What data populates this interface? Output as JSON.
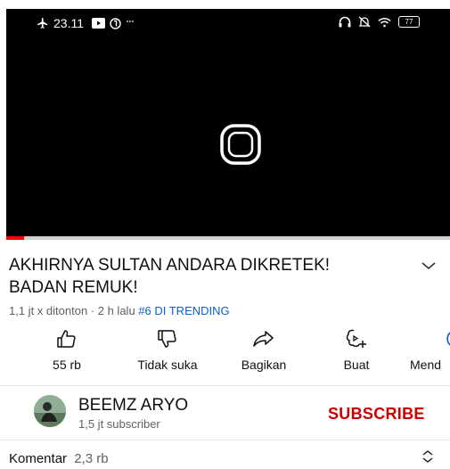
{
  "status_bar": {
    "time": "23.11",
    "battery": "77",
    "icons": [
      "airplane-icon",
      "youtube-icon",
      "notification-icon",
      "dots-icon",
      "headphones-icon",
      "mute-icon",
      "wifi-icon",
      "battery-icon"
    ]
  },
  "player": {
    "control_icon": "pause-icon",
    "progress": 0.04,
    "progress_color": "#ff0000"
  },
  "video": {
    "title": "AKHIRNYA SULTAN ANDARA DIKRETEK! BADAN REMUK!",
    "views": "1,1 jt x ditonton",
    "age": "2 h lalu",
    "trending": "#6 DI TRENDING"
  },
  "actions": [
    {
      "icon": "thumbs-up-icon",
      "label": "55 rb"
    },
    {
      "icon": "thumbs-down-icon",
      "label": "Tidak suka"
    },
    {
      "icon": "share-icon",
      "label": "Bagikan"
    },
    {
      "icon": "create-icon",
      "label": "Buat"
    },
    {
      "icon": "download-icon",
      "label": "Mend"
    }
  ],
  "channel": {
    "name": "BEEMZ ARYO",
    "subscribers": "1,5 jt subscriber",
    "subscribe_label": "SUBSCRIBE",
    "subscribe_color": "#cc0000"
  },
  "comments": {
    "label": "Komentar",
    "count": "2,3 rb"
  }
}
